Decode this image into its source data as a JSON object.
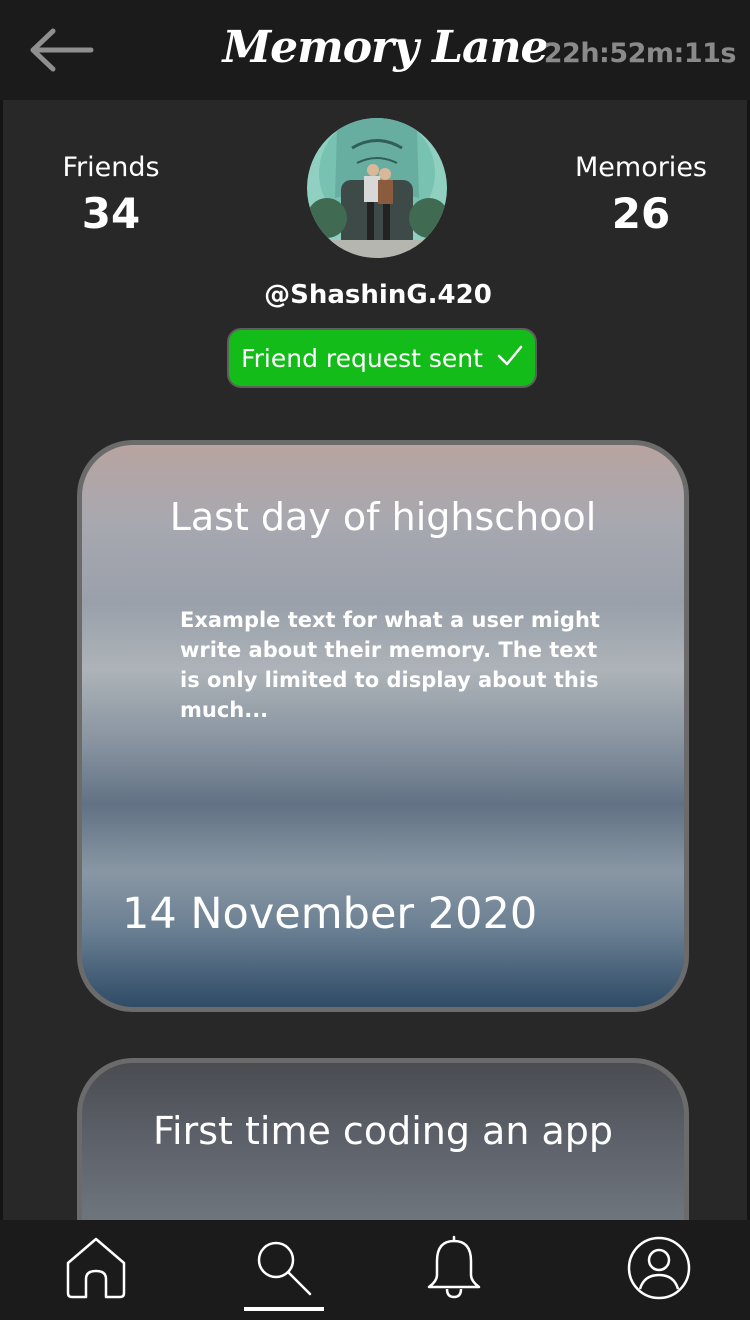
{
  "header": {
    "title": "Memory Lane",
    "timer": "22h:52m:11s",
    "back_icon": "arrow-left-icon"
  },
  "profile": {
    "friends_label": "Friends",
    "friends_count": "34",
    "memories_label": "Memories",
    "memories_count": "26",
    "username": "@ShashinG.420",
    "friend_request_label": "Friend request sent",
    "friend_request_icon": "checkmark-icon",
    "accent_color": "#14bc1a"
  },
  "memories": [
    {
      "title": "Last day of highschool",
      "text": "Example text for what a user might write about their memory. The text is only limited to display about this much...",
      "date": "14 November 2020"
    },
    {
      "title": "First time coding an app"
    }
  ],
  "bottom_nav": {
    "items": [
      {
        "icon": "home-icon"
      },
      {
        "icon": "search-icon",
        "active": true
      },
      {
        "icon": "bell-icon"
      },
      {
        "icon": "user-profile-icon"
      }
    ]
  }
}
